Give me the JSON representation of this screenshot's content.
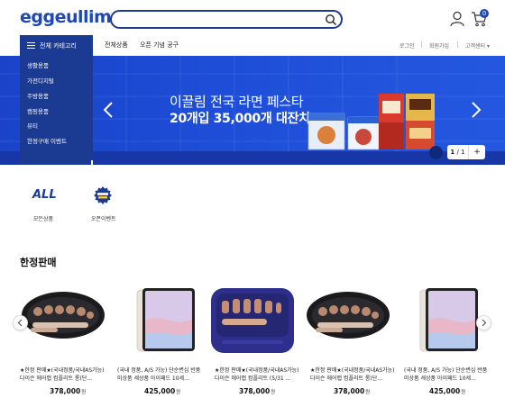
{
  "header": {
    "logo": "eggeullim",
    "search_value": "",
    "cart_count": "0"
  },
  "nav": {
    "category_label": "전체 카테고리",
    "links": [
      "전체상품",
      "오픈 기념 공구"
    ],
    "top_links": [
      "로그인",
      "회원가입",
      "고객센터 ▾"
    ]
  },
  "categories": [
    "생활용품",
    "가전디지털",
    "주방용품",
    "캠핑용품",
    "뷰티",
    "한정구매 이벤트"
  ],
  "banner": {
    "line1": "이끌림 전국 라면 페스타",
    "line2": "20개입 35,000개 대잔치",
    "page_current": "1",
    "page_total": "1",
    "accent": "#1e4ed8"
  },
  "quick_menu": [
    {
      "icon": "all-text-icon",
      "text": "ALL",
      "label": "모든상품"
    },
    {
      "icon": "grand-open-badge-icon",
      "label": "오픈이벤트"
    }
  ],
  "section": {
    "title": "한정판매"
  },
  "products": [
    {
      "name": "★한정 판매★(국내정품/국내AS가능)다이슨 에어랩 컴플리트 롱(단...",
      "price": "378,000",
      "unit": "원",
      "image": "hair-styler-case"
    },
    {
      "name": "(국내 정품, A/S 가능) 단순변심 반품 미상품 세상품 아이패드 10세...",
      "price": "425,000",
      "unit": "원",
      "image": "tablet"
    },
    {
      "name": "★한정 판매★(국내정품/국내AS가능)다이슨 에어랩 컴플리트 (5/31 ...",
      "price": "378,000",
      "unit": "원",
      "image": "styler-case-blue"
    },
    {
      "name": "★한정 판매★(국내정품/국내AS가능)다이슨 에어랩 컴플리트 롱(단...",
      "price": "378,000",
      "unit": "원",
      "image": "hair-styler-case"
    },
    {
      "name": "(국내 정품, A/S 가능) 단순변심 반품 미상품 세상품 아이패드 10세...",
      "price": "425,000",
      "unit": "원",
      "image": "tablet"
    }
  ]
}
